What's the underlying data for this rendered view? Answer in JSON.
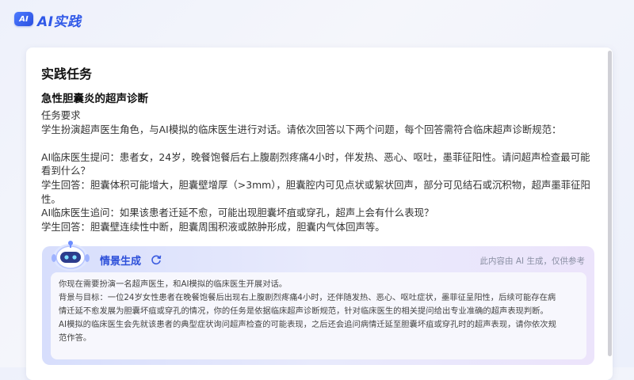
{
  "app": {
    "logo_text": "AI",
    "title": "AI实践"
  },
  "section_title": "实践任务",
  "case_title": "急性胆囊炎的超声诊断",
  "task": {
    "lines": [
      "任务要求",
      "学生扮演超声医生角色，与AI模拟的临床医生进行对话。请依次回答以下两个问题，每个回答需符合临床超声诊断规范：",
      "",
      "AI临床医生提问：患者女，24岁，晚餐饱餐后右上腹剧烈疼痛4小时，伴发热、恶心、呕吐，墨菲征阳性。请问超声检查最可能",
      "看到什么？",
      "学生回答：胆囊体积可能增大，胆囊壁增厚（>3mm），胆囊腔内可见点状或絮状回声，部分可见结石或沉积物，超声墨菲征阳",
      "性。",
      "AI临床医生追问：如果该患者迁延不愈，可能出现胆囊坏疽或穿孔，超声上会有什么表现？",
      "学生回答：胆囊壁连续性中断，胆囊周围积液或脓肿形成，胆囊内气体回声等。"
    ]
  },
  "scene": {
    "title": "情景生成",
    "disclaimer": "此内容由 AI 生成，仅供参考",
    "lines": [
      "你现在需要扮演一名超声医生，和AI模拟的临床医生开展对话。",
      "背景与目标：一位24岁女性患者在晚餐饱餐后出现右上腹剧烈疼痛4小时，还伴随发热、恶心、呕吐症状，墨菲征呈阳性，后续可能存在病",
      "情迁延不愈发展为胆囊坏疽或穿孔的情况，你的任务是依据临床超声诊断规范，针对临床医生的相关提问给出专业准确的超声表现判断。",
      "AI模拟的临床医生会先就该患者的典型症状询问超声检查的可能表现，之后还会追问病情迁延至胆囊坏疽或穿孔时的超声表现，请你依次规",
      "范作答。"
    ]
  },
  "icons": {
    "logo": "ai-logo-icon",
    "robot": "robot-mascot-icon",
    "refresh": "refresh-icon"
  },
  "colors": {
    "accent": "#2f58e8",
    "scene_title": "#2c4fd9"
  }
}
